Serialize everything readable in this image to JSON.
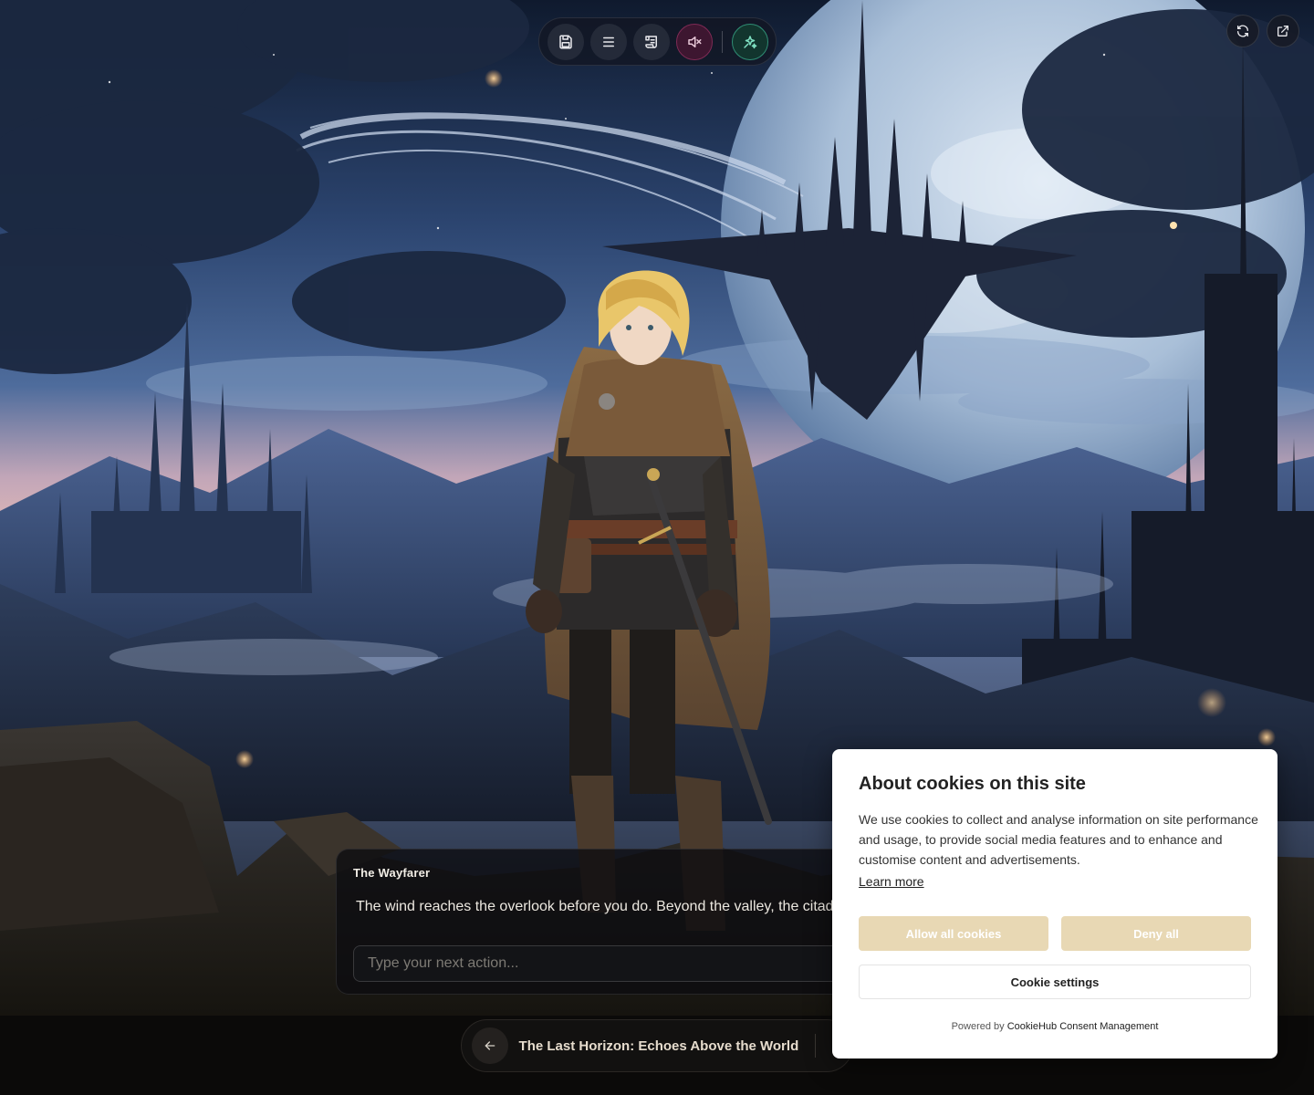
{
  "toolbar": {
    "buttons": [
      {
        "icon": "save-icon",
        "label": "Save"
      },
      {
        "icon": "menu-icon",
        "label": "Menu"
      },
      {
        "icon": "scroll-icon",
        "label": "History"
      },
      {
        "icon": "mute-icon",
        "label": "Mute"
      },
      {
        "icon": "sparkle-icon",
        "label": "Magic"
      }
    ],
    "mute_color": "#7e2b55",
    "spark_color": "#2f8d74"
  },
  "corner": {
    "refresh_icon": "refresh-icon",
    "external_icon": "external-link-icon"
  },
  "dialogue": {
    "speaker": "The Wayfarer",
    "text": "The wind reaches the overlook before you do. Beyond the valley, the citadel",
    "input_placeholder": "Type your next action..."
  },
  "story": {
    "title": "The Last Horizon: Echoes Above the World",
    "back_icon": "arrow-left-icon",
    "expand_icon": "chevrons-down-icon"
  },
  "cookie": {
    "title": "About cookies on this site",
    "body": "We use cookies to collect and analyse information on site performance and usage, to provide social media features and to enhance and customise content and advertisements.",
    "learn_more": "Learn more",
    "allow_label": "Allow all cookies",
    "deny_label": "Deny all",
    "settings_label": "Cookie settings",
    "powered_prefix": "Powered by ",
    "powered_link": "CookieHub Consent Management",
    "accent_color": "#e8d8b4"
  }
}
